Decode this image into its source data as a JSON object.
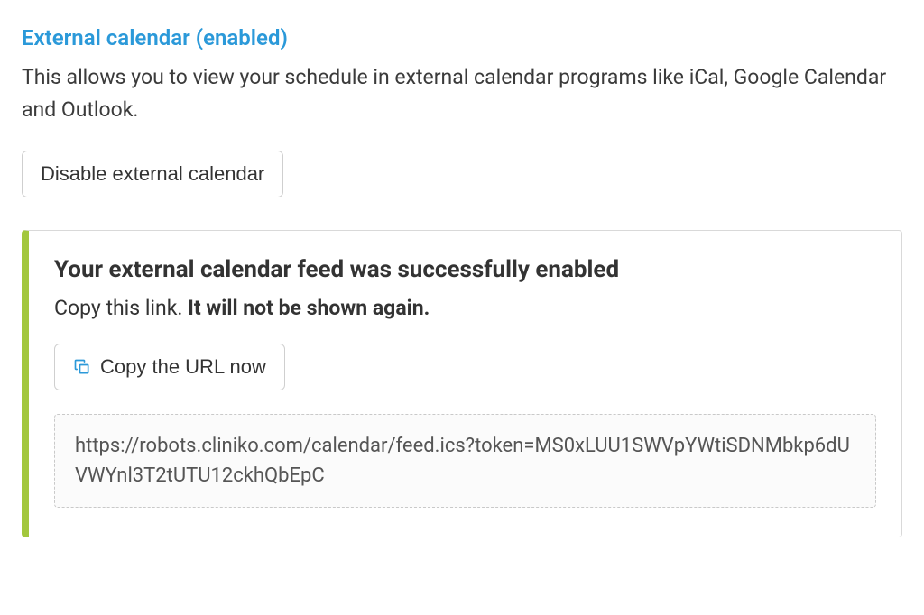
{
  "heading": "External calendar (enabled)",
  "description": "This allows you to view your schedule in external calendar programs like iCal, Google Calendar and Outlook.",
  "buttons": {
    "disable_label": "Disable external calendar",
    "copy_label": "Copy the URL now"
  },
  "notice": {
    "title": "Your external calendar feed was successfully enabled",
    "subline_plain": "Copy this link. ",
    "subline_bold": "It will not be shown again.",
    "url": "https://robots.cliniko.com/calendar/feed.ics?token=MS0xLUU1SWVpYWtiSDNMbkp6dUVWYnl3T2tUTU12ckhQbEpC"
  },
  "colors": {
    "accent_blue": "#2b99d9",
    "accent_green": "#a2c73d"
  }
}
